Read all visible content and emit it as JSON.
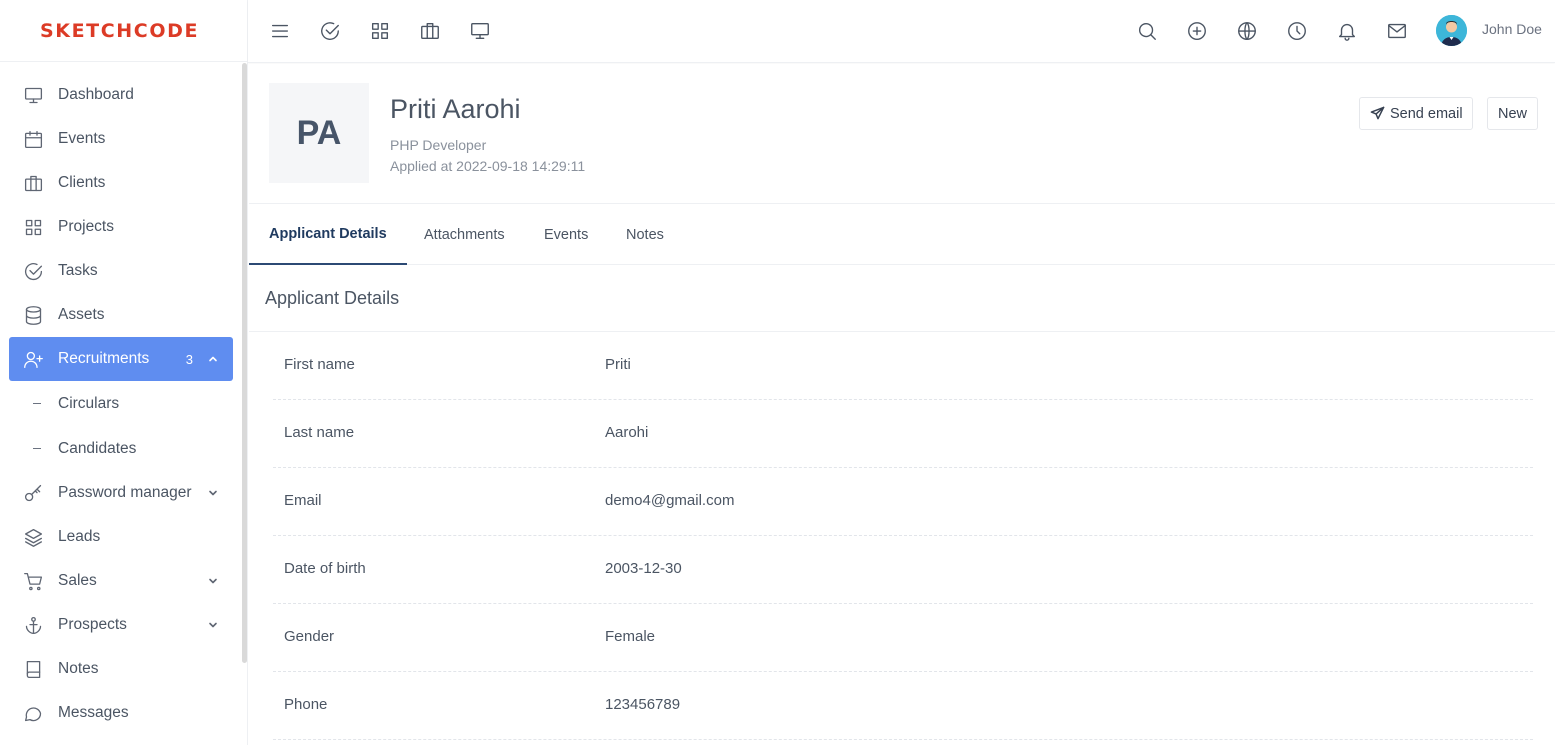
{
  "brand": {
    "name": "SKETCHCODE",
    "color": "#dc3b26"
  },
  "sidebar": {
    "items": [
      {
        "label": "Dashboard",
        "icon": "monitor-icon"
      },
      {
        "label": "Events",
        "icon": "calendar-icon"
      },
      {
        "label": "Clients",
        "icon": "briefcase-icon"
      },
      {
        "label": "Projects",
        "icon": "grid-icon"
      },
      {
        "label": "Tasks",
        "icon": "check-circle-icon"
      },
      {
        "label": "Assets",
        "icon": "database-icon"
      },
      {
        "label": "Recruitments",
        "icon": "user-plus-icon",
        "badge": "3",
        "active": true,
        "expanded": true
      },
      {
        "label": "Circulars",
        "sub": true
      },
      {
        "label": "Candidates",
        "sub": true
      },
      {
        "label": "Password manager",
        "icon": "key-icon",
        "collapsible": true
      },
      {
        "label": "Leads",
        "icon": "layers-icon"
      },
      {
        "label": "Sales",
        "icon": "cart-icon",
        "collapsible": true
      },
      {
        "label": "Prospects",
        "icon": "anchor-icon",
        "collapsible": true
      },
      {
        "label": "Notes",
        "icon": "book-icon"
      },
      {
        "label": "Messages",
        "icon": "message-circle-icon"
      }
    ],
    "active_color": "#5f8df0"
  },
  "topbar": {
    "left_icons": [
      "menu-icon",
      "check-circle-icon",
      "grid-icon",
      "briefcase-icon",
      "monitor-icon"
    ],
    "right_icons": [
      "search-icon",
      "plus-circle-icon",
      "globe-icon",
      "clock-icon",
      "bell-icon",
      "mail-icon"
    ],
    "user_name": "John Doe"
  },
  "candidate": {
    "initials": "PA",
    "name": "Priti Aarohi",
    "role": "PHP Developer",
    "applied": "Applied at 2022-09-18 14:29:11"
  },
  "actions": {
    "send_email": "Send email",
    "new": "New"
  },
  "tabs": [
    {
      "label": "Applicant Details",
      "active": true
    },
    {
      "label": "Attachments"
    },
    {
      "label": "Events"
    },
    {
      "label": "Notes"
    }
  ],
  "section_title": "Applicant Details",
  "details": [
    {
      "label": "First name",
      "value": "Priti"
    },
    {
      "label": "Last name",
      "value": "Aarohi"
    },
    {
      "label": "Email",
      "value": "demo4@gmail.com"
    },
    {
      "label": "Date of birth",
      "value": "2003-12-30"
    },
    {
      "label": "Gender",
      "value": "Female"
    },
    {
      "label": "Phone",
      "value": "123456789"
    }
  ]
}
